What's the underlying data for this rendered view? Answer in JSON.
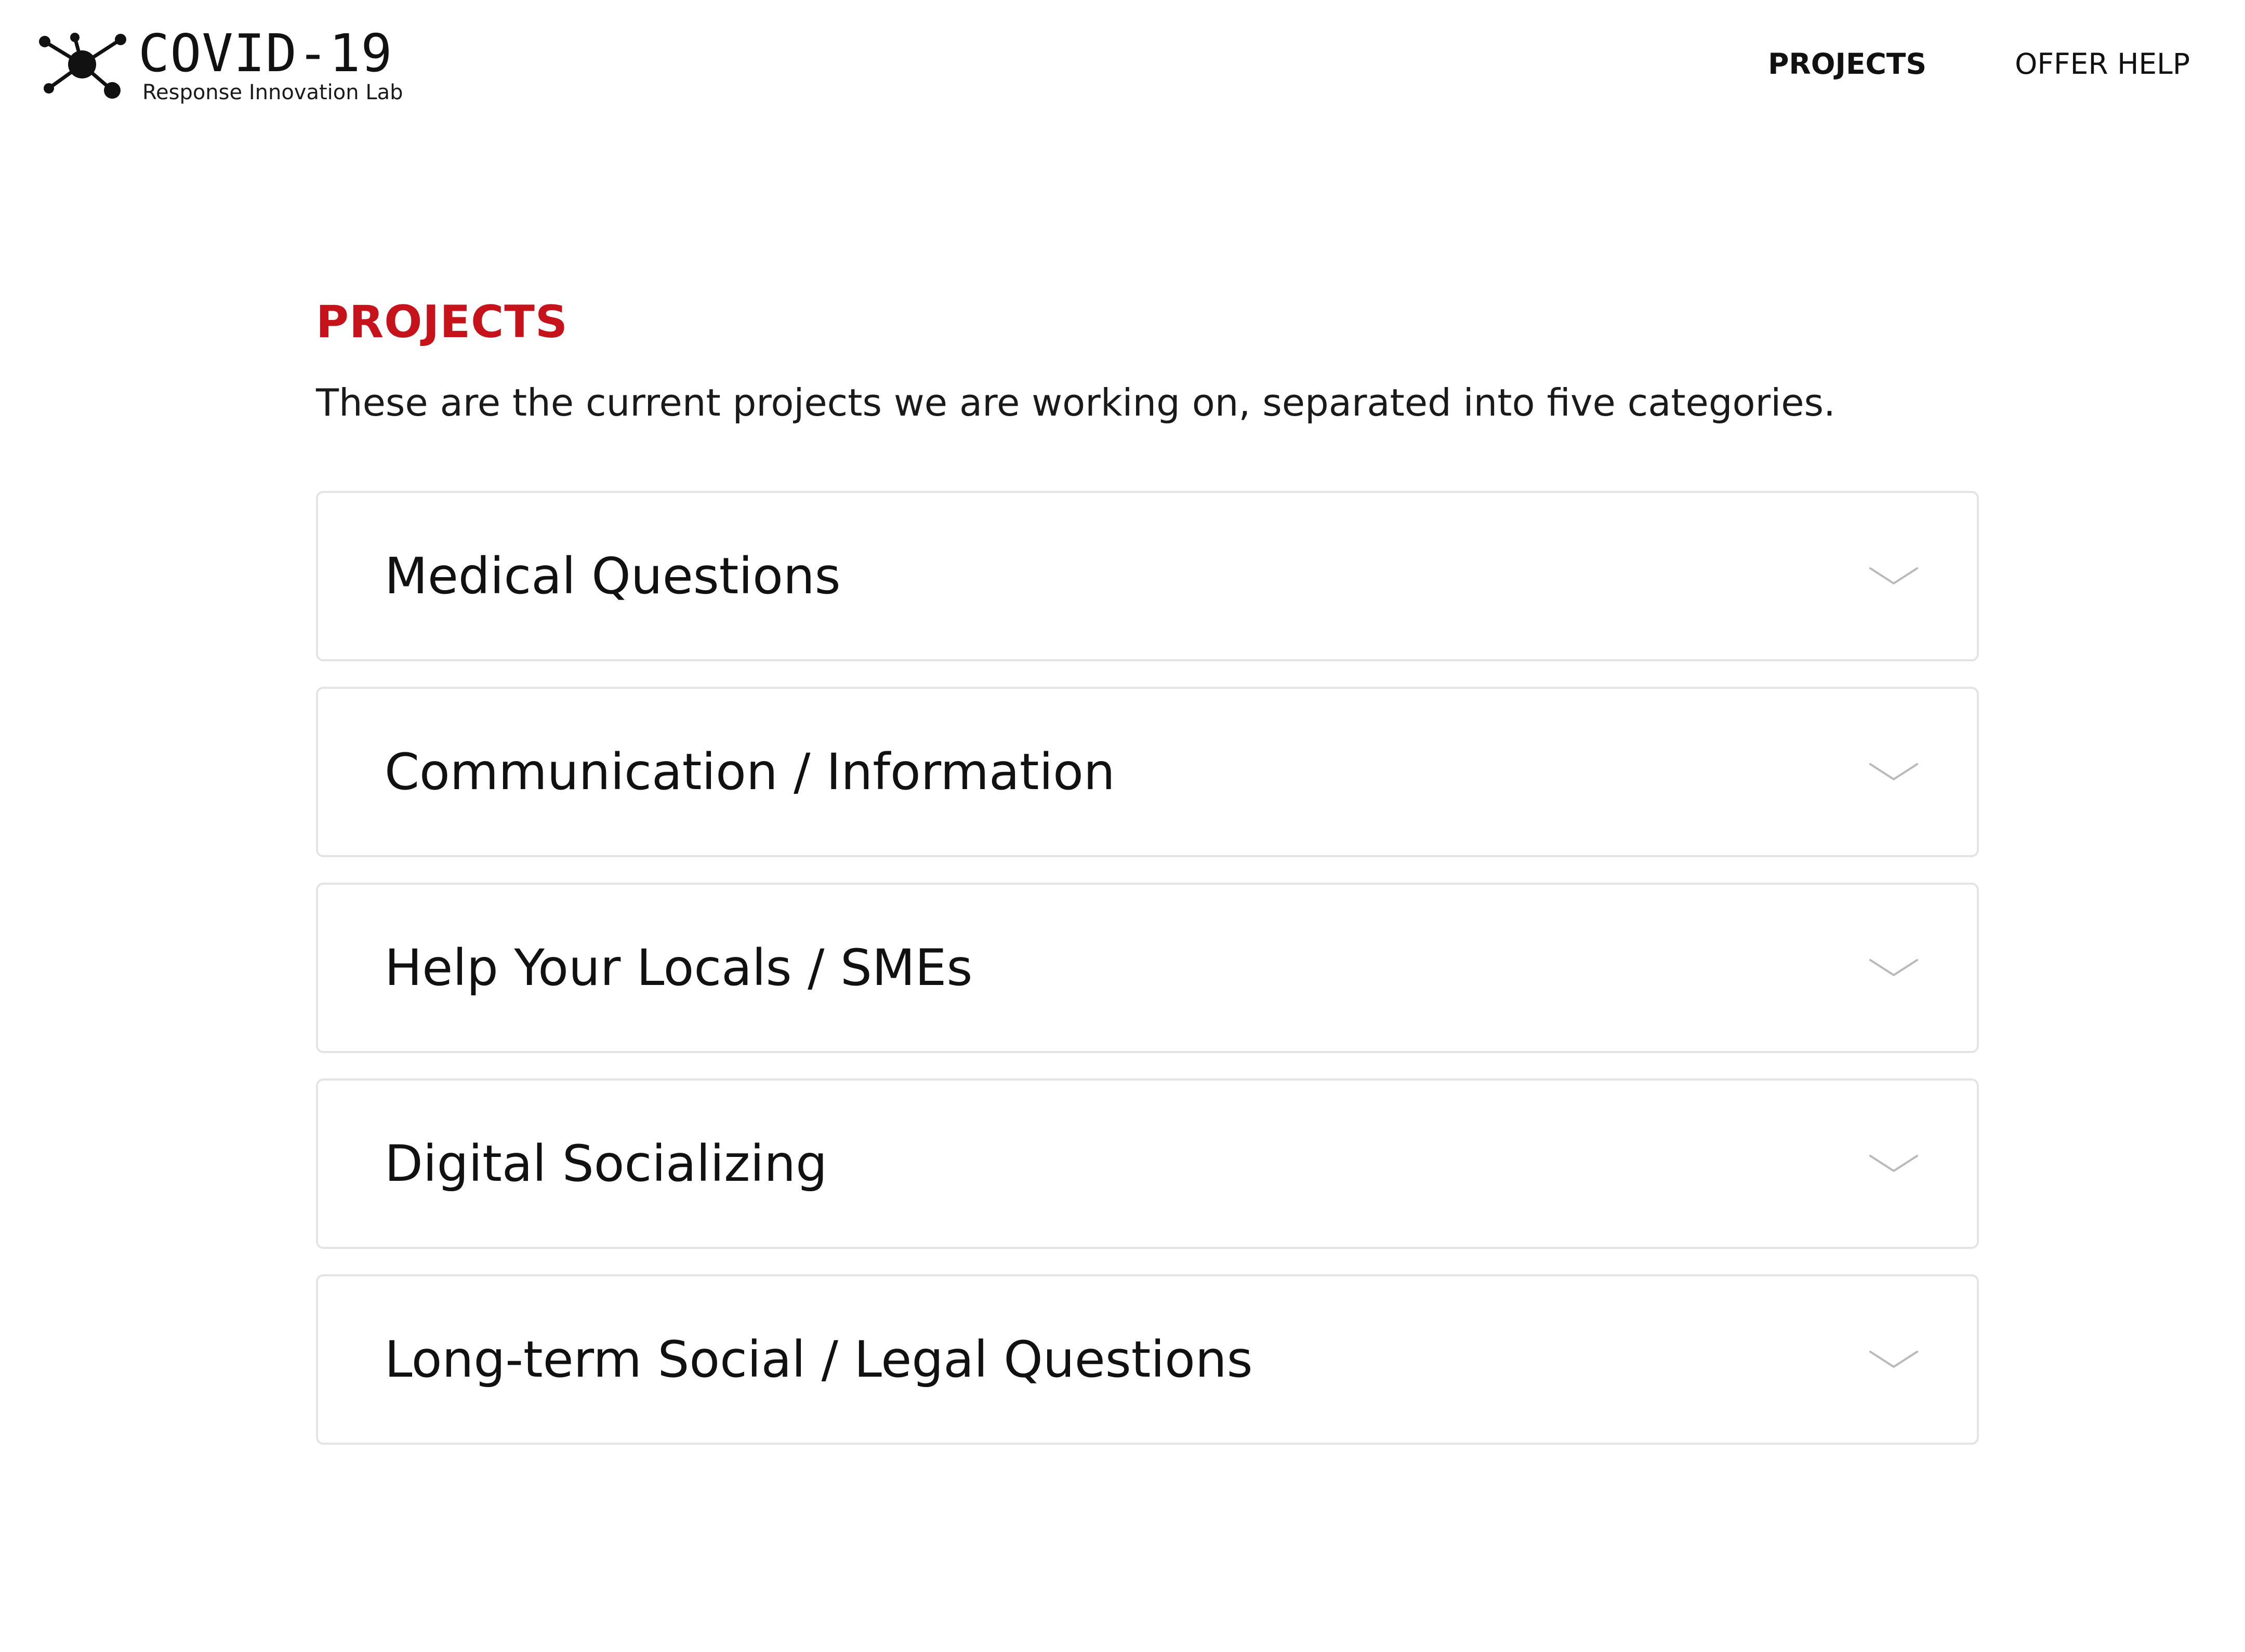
{
  "brand": {
    "title": "COVID-19",
    "subtitle": "Response Innovation Lab",
    "logo_icon": "molecule-network-icon"
  },
  "nav": {
    "items": [
      {
        "label": "PROJECTS",
        "active": true
      },
      {
        "label": "OFFER HELP",
        "active": false
      }
    ]
  },
  "main": {
    "title": "PROJECTS",
    "intro": "These are the current projects we are working on, separated into five categories.",
    "categories": [
      {
        "label": "Medical Questions",
        "icon": "chevron-down-icon",
        "expanded": false
      },
      {
        "label": "Communication / Information",
        "icon": "chevron-down-icon",
        "expanded": false
      },
      {
        "label": "Help Your Locals / SMEs",
        "icon": "chevron-down-icon",
        "expanded": false
      },
      {
        "label": "Digital Socializing",
        "icon": "chevron-down-icon",
        "expanded": false
      },
      {
        "label": "Long-term Social / Legal Questions",
        "icon": "chevron-down-icon",
        "expanded": false
      }
    ]
  },
  "colors": {
    "accent": "#c6131b",
    "text": "#111111",
    "card_border": "#e4e4e4",
    "chevron": "#b9b9b9",
    "background": "#ffffff"
  }
}
